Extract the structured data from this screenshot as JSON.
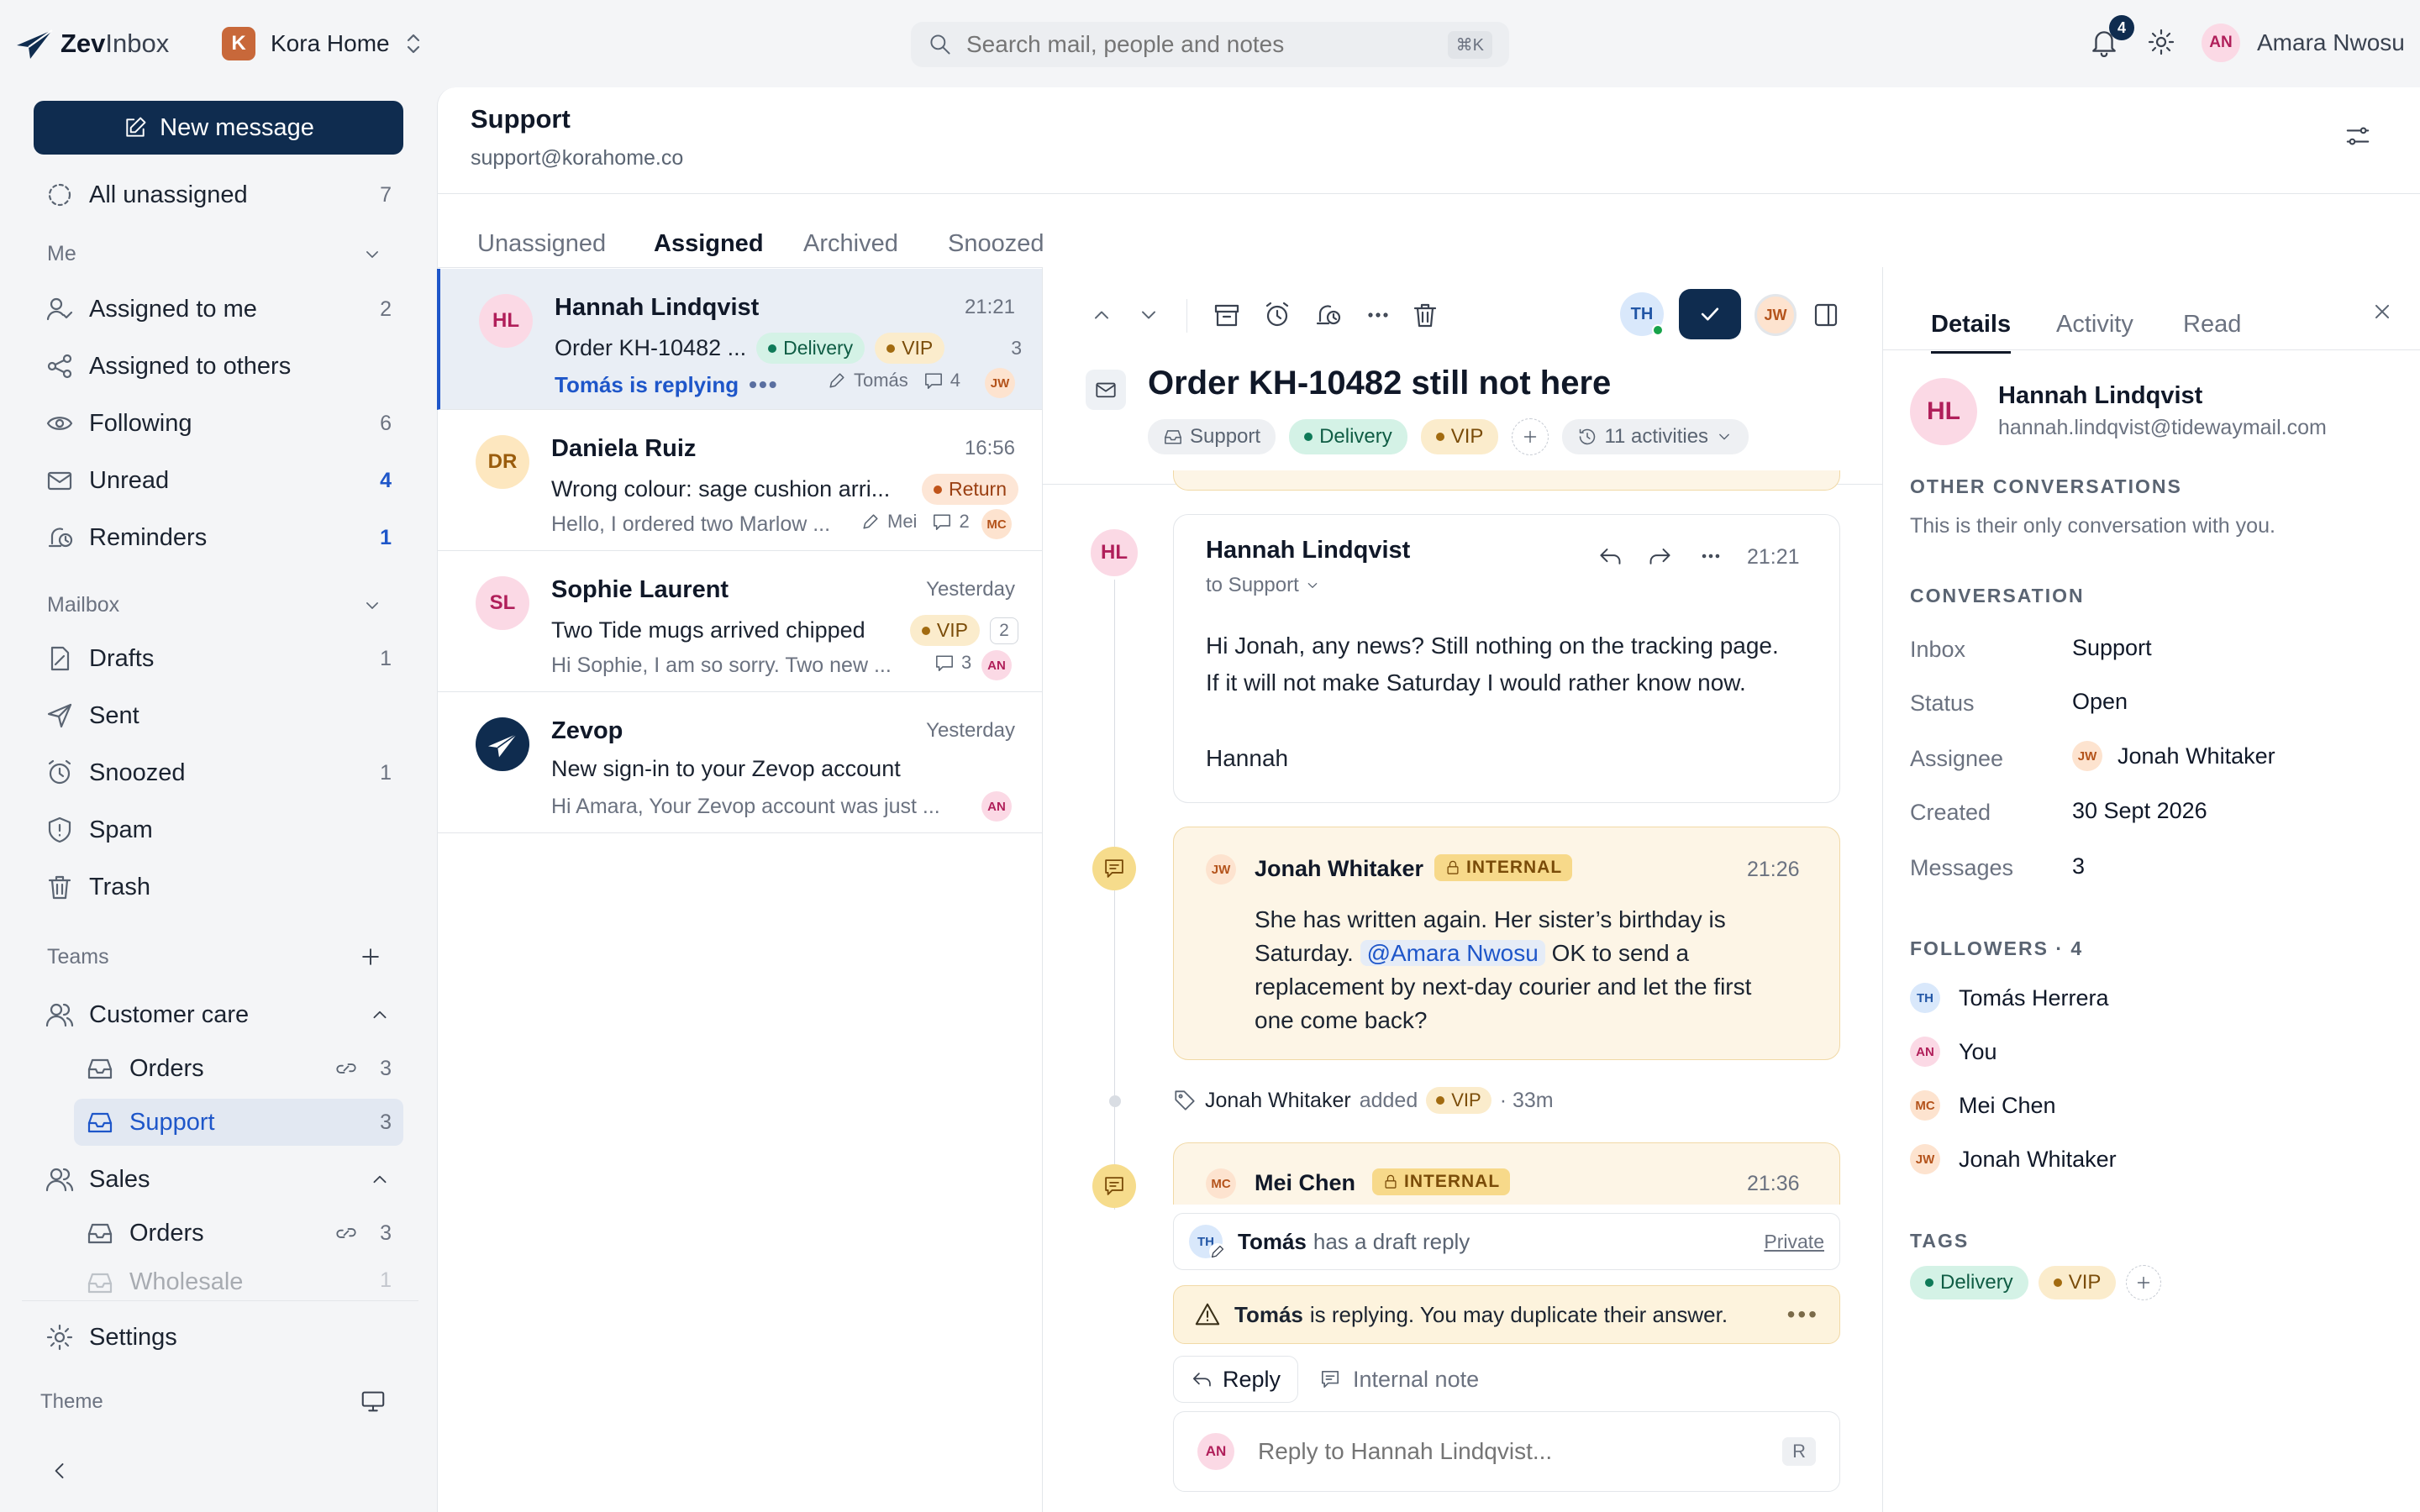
{
  "app": {
    "name_part1": "Zev",
    "name_part2": "Inbox",
    "workspace_initial": "K",
    "workspace_name": "Kora Home"
  },
  "search": {
    "placeholder": "Search mail, people and notes",
    "shortcut": "⌘K"
  },
  "user": {
    "notifications": "4",
    "initials": "AN",
    "name": "Amara Nwosu"
  },
  "sidebar": {
    "new_message": "New message",
    "all_unassigned": {
      "label": "All unassigned",
      "count": "7"
    },
    "me_section": "Me",
    "me_items": [
      {
        "label": "Assigned to me",
        "count": "2"
      },
      {
        "label": "Assigned to others",
        "count": ""
      },
      {
        "label": "Following",
        "count": "6"
      },
      {
        "label": "Unread",
        "count": "4"
      },
      {
        "label": "Reminders",
        "count": "1"
      }
    ],
    "mailbox_section": "Mailbox",
    "mailbox_items": [
      {
        "label": "Drafts",
        "count": "1"
      },
      {
        "label": "Sent",
        "count": ""
      },
      {
        "label": "Snoozed",
        "count": "1"
      },
      {
        "label": "Spam",
        "count": ""
      },
      {
        "label": "Trash",
        "count": ""
      }
    ],
    "teams_section": "Teams",
    "teams": [
      {
        "label": "Customer care",
        "children": [
          {
            "label": "Orders",
            "count": "3"
          },
          {
            "label": "Support",
            "count": "3"
          }
        ]
      },
      {
        "label": "Sales",
        "children": [
          {
            "label": "Orders",
            "count": "3"
          },
          {
            "label": "Wholesale",
            "count": "1"
          }
        ]
      }
    ],
    "settings": "Settings",
    "theme": "Theme"
  },
  "inbox": {
    "title": "Support",
    "email": "support@korahome.co"
  },
  "tabs": [
    "Unassigned",
    "Assigned",
    "Archived",
    "Snoozed"
  ],
  "conversations": [
    {
      "initials": "HL",
      "name": "Hannah Lindqvist",
      "time": "21:21",
      "subject": "Order KH-10482 ...",
      "tags": [
        "Delivery",
        "VIP"
      ],
      "count": "3",
      "status": "Tomás is replying",
      "draft_by": "Tomás",
      "notes": "4",
      "assignee": "JW"
    },
    {
      "initials": "DR",
      "name": "Daniela Ruiz",
      "time": "16:56",
      "subject": "Wrong colour: sage cushion arri...",
      "tags": [
        "Return"
      ],
      "preview": "Hello, I ordered two Marlow ...",
      "draft_by": "Mei",
      "notes": "2",
      "assignee": "MC"
    },
    {
      "initials": "SL",
      "name": "Sophie Laurent",
      "time": "Yesterday",
      "subject": "Two Tide mugs arrived chipped",
      "tags": [
        "VIP"
      ],
      "count": "2",
      "preview": "Hi Sophie, I am so sorry. Two new ...",
      "notes": "3",
      "assignee": "AN"
    },
    {
      "name": "Zevop",
      "time": "Yesterday",
      "subject": "New sign-in to your Zevop account",
      "preview": "Hi Amara, Your Zevop account was just ...",
      "assignee": "AN"
    }
  ],
  "thread": {
    "subject": "Order KH-10482 still not here",
    "inbox_tag": "Support",
    "tags": [
      "Delivery",
      "VIP"
    ],
    "activities": "11 activities",
    "toolbar_avatars": [
      "TH",
      "JW"
    ],
    "message": {
      "initials": "HL",
      "from": "Hannah Lindqvist",
      "to": "to Support",
      "time": "21:21",
      "line1": "Hi Jonah, any news? Still nothing on the tracking page.",
      "line2": "If it will not make Saturday I would rather know now.",
      "sign": "Hannah"
    },
    "note1": {
      "initials": "JW",
      "author": "Jonah Whitaker",
      "badge": "INTERNAL",
      "time": "21:26",
      "text1": "She has written again. Her sister’s birthday is",
      "text2a": "Saturday.",
      "mention": "@Amara Nwosu",
      "text2b": "OK to send a",
      "text3": "replacement by next-day courier and let the first",
      "text4": "one come back?"
    },
    "event": {
      "actor": "Jonah Whitaker",
      "verb": "added",
      "tag": "VIP",
      "ago": "· 33m"
    },
    "note2": {
      "initials": "MC",
      "author": "Mei Chen",
      "badge": "INTERNAL",
      "time": "21:36"
    },
    "draft": {
      "initials": "TH",
      "who": "Tomás",
      "text": "has a draft reply",
      "private": "Private"
    },
    "warning": {
      "who": "Tomás",
      "text": "is replying. You may duplicate their answer."
    },
    "reply_tab": "Reply",
    "note_tab": "Internal note",
    "composer": {
      "initials": "AN",
      "placeholder": "Reply to Hannah Lindqvist...",
      "key": "R"
    }
  },
  "details": {
    "tabs": [
      "Details",
      "Activity",
      "Read"
    ],
    "contact": {
      "initials": "HL",
      "name": "Hannah Lindqvist",
      "email": "hannah.lindqvist@tidewaymail.com"
    },
    "other_title": "OTHER CONVERSATIONS",
    "other_text": "This is their only conversation with you.",
    "conversation_title": "CONVERSATION",
    "fields": [
      {
        "label": "Inbox",
        "value": "Support"
      },
      {
        "label": "Status",
        "value": "Open"
      },
      {
        "label": "Assignee",
        "value": "Jonah Whitaker",
        "initials": "JW"
      },
      {
        "label": "Created",
        "value": "30 Sept 2026"
      },
      {
        "label": "Messages",
        "value": "3"
      }
    ],
    "followers_title": "FOLLOWERS · 4",
    "followers": [
      {
        "initials": "TH",
        "name": "Tomás Herrera"
      },
      {
        "initials": "AN",
        "name": "You"
      },
      {
        "initials": "MC",
        "name": "Mei Chen"
      },
      {
        "initials": "JW",
        "name": "Jonah Whitaker"
      }
    ],
    "tags_title": "TAGS",
    "tags": [
      "Delivery",
      "VIP"
    ]
  }
}
